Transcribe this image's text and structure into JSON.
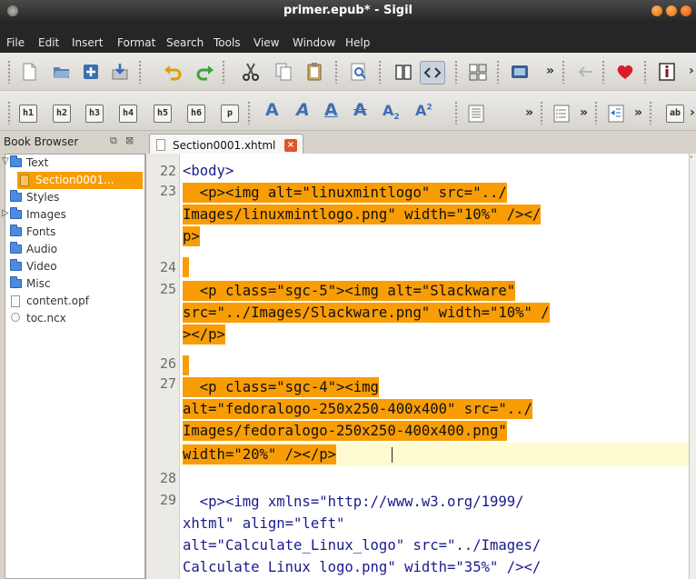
{
  "window": {
    "title": "primer.epub* - Sigil",
    "controls": [
      "close",
      "minimize",
      "maximize"
    ]
  },
  "menu": [
    "File",
    "Edit",
    "Insert",
    "Format",
    "Search",
    "Tools",
    "View",
    "Window",
    "Help"
  ],
  "toolbar1": {
    "icons": [
      "new-file-icon",
      "open-folder-icon",
      "add-file-icon",
      "save-icon",
      "undo-icon",
      "redo-icon",
      "cut-icon",
      "copy-icon",
      "paste-icon",
      "find-icon",
      "book-view-icon",
      "code-view-icon",
      "split-view-icon",
      "insert-image-icon",
      "back-icon",
      "heart-icon",
      "info-icon"
    ]
  },
  "toolbar2": {
    "headings": [
      "h1",
      "h2",
      "h3",
      "h4",
      "h5",
      "h6",
      "p"
    ],
    "more": "»",
    "ab": "ab"
  },
  "book_browser": {
    "title": "Book Browser",
    "items": [
      {
        "label": "Text",
        "type": "folder",
        "expanded": true
      },
      {
        "label": "Section0001...",
        "type": "file",
        "selected": true
      },
      {
        "label": "Styles",
        "type": "folder"
      },
      {
        "label": "Images",
        "type": "folder",
        "collapsed": true
      },
      {
        "label": "Fonts",
        "type": "folder"
      },
      {
        "label": "Audio",
        "type": "folder"
      },
      {
        "label": "Video",
        "type": "folder"
      },
      {
        "label": "Misc",
        "type": "folder"
      },
      {
        "label": "content.opf",
        "type": "file"
      },
      {
        "label": "toc.ncx",
        "type": "file"
      }
    ]
  },
  "tab": {
    "label": "Section0001.xhtml"
  },
  "code": {
    "line_numbers": [
      "22",
      "23",
      "24",
      "25",
      "26",
      "27",
      "28",
      "29"
    ],
    "lines": [
      "<body>",
      "  <p><img alt=\"linuxmintlogo\" src=\"../",
      "Images/linuxmintlogo.png\" width=\"10%\" /></",
      "p>",
      " ",
      "  <p class=\"sgc-5\"><img alt=\"Slackware\"",
      "src=\"../Images/Slackware.png\" width=\"10%\" /",
      "></p>",
      " ",
      "  <p class=\"sgc-4\"><img",
      "alt=\"fedoralogo-250x250-400x400\" src=\"../",
      "Images/fedoralogo-250x250-400x400.png\"",
      "width=\"20%\" /></p>",
      "",
      "  <p><img xmlns=\"http://www.w3.org/1999/",
      "xhtml\" align=\"left\"",
      "alt=\"Calculate_Linux_logo\" src=\"../Images/",
      "Calculate Linux logo.png\" width=\"35%\" /></"
    ]
  },
  "colors": {
    "selection": "#f89d06",
    "current_line": "#fffbd1",
    "menu_bg": "#262626",
    "accent_blue": "#3f6fb5"
  }
}
